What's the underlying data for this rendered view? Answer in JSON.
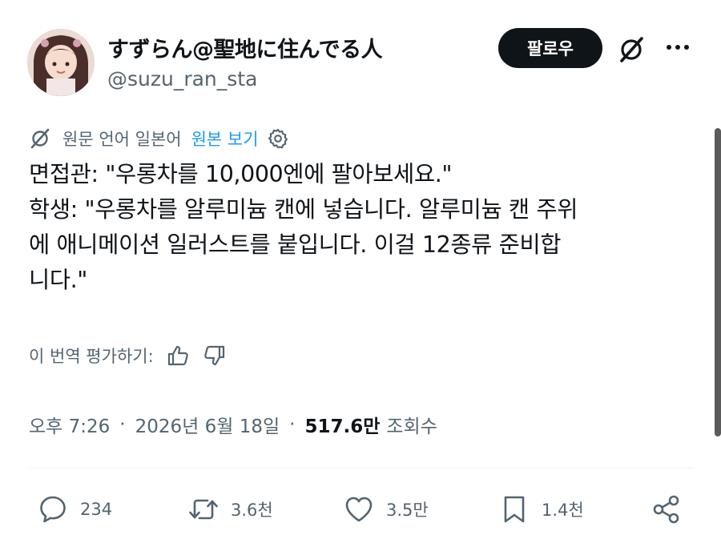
{
  "author": {
    "display_name": "すずらん@聖地に住んでる人",
    "handle": "@suzu_ran_sta"
  },
  "header": {
    "follow_label": "팔로우",
    "grok_icon": "grok-icon",
    "more_icon": "more-dots-icon"
  },
  "translation": {
    "notice": "원문 언어 일본어",
    "show_original": "원본 보기"
  },
  "tweet": {
    "lines": [
      "면접관: \"우롱차를 10,000엔에 팔아보세요.\"",
      "학생: \"우롱차를 알루미늄 캔에 넣습니다. 알루미늄 캔 주위",
      "에 애니메이션 일러스트를 붙입니다. 이걸 12종류 준비합",
      "니다.\""
    ]
  },
  "rating": {
    "label": "이 번역 평가하기:"
  },
  "meta": {
    "time": "오후 7:26",
    "separator": "·",
    "date": "2026년 6월 18일",
    "views_count": "517.6만",
    "views_label": "조회수"
  },
  "actions": {
    "replies": "234",
    "reposts": "3.6천",
    "likes": "3.5만",
    "bookmarks": "1.4천"
  },
  "colors": {
    "text": "#0f1419",
    "secondary": "#536471",
    "link": "#1d9bf0",
    "button_bg": "#0f1419"
  }
}
